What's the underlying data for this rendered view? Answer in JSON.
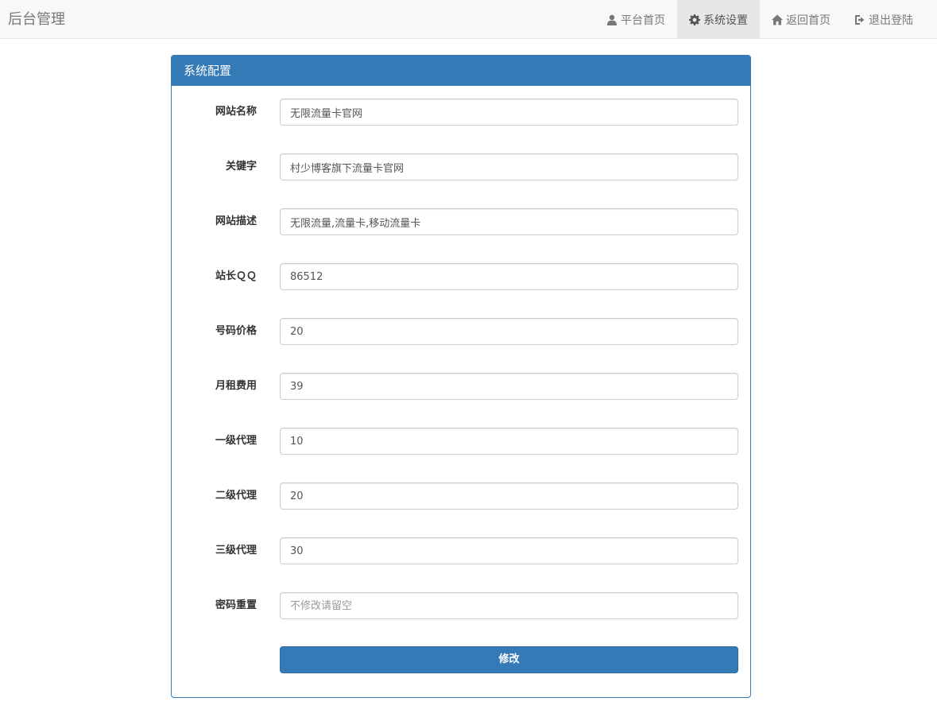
{
  "navbar": {
    "brand": "后台管理",
    "items": [
      {
        "label": "平台首页",
        "icon": "user-icon",
        "active": false
      },
      {
        "label": "系统设置",
        "icon": "gear-icon",
        "active": true
      },
      {
        "label": "返回首页",
        "icon": "home-icon",
        "active": false
      },
      {
        "label": "退出登陆",
        "icon": "logout-icon",
        "active": false
      }
    ]
  },
  "panel": {
    "title": "系统配置",
    "fields": [
      {
        "label": "网站名称",
        "value": "无限流量卡官网",
        "placeholder": ""
      },
      {
        "label": "关键字",
        "value": "村少博客旗下流量卡官网",
        "placeholder": ""
      },
      {
        "label": "网站描述",
        "value": "无限流量,流量卡,移动流量卡",
        "placeholder": ""
      },
      {
        "label": "站长ＱＱ",
        "value": "86512",
        "placeholder": ""
      },
      {
        "label": "号码价格",
        "value": "20",
        "placeholder": ""
      },
      {
        "label": "月租费用",
        "value": "39",
        "placeholder": ""
      },
      {
        "label": "一级代理",
        "value": "10",
        "placeholder": ""
      },
      {
        "label": "二级代理",
        "value": "20",
        "placeholder": ""
      },
      {
        "label": "三级代理",
        "value": "30",
        "placeholder": ""
      },
      {
        "label": "密码重置",
        "value": "",
        "placeholder": "不修改请留空"
      }
    ],
    "submit_label": "修改"
  },
  "colors": {
    "primary": "#337ab7",
    "navbar_bg": "#f8f8f8",
    "nav_active_bg": "#e7e7e7"
  }
}
